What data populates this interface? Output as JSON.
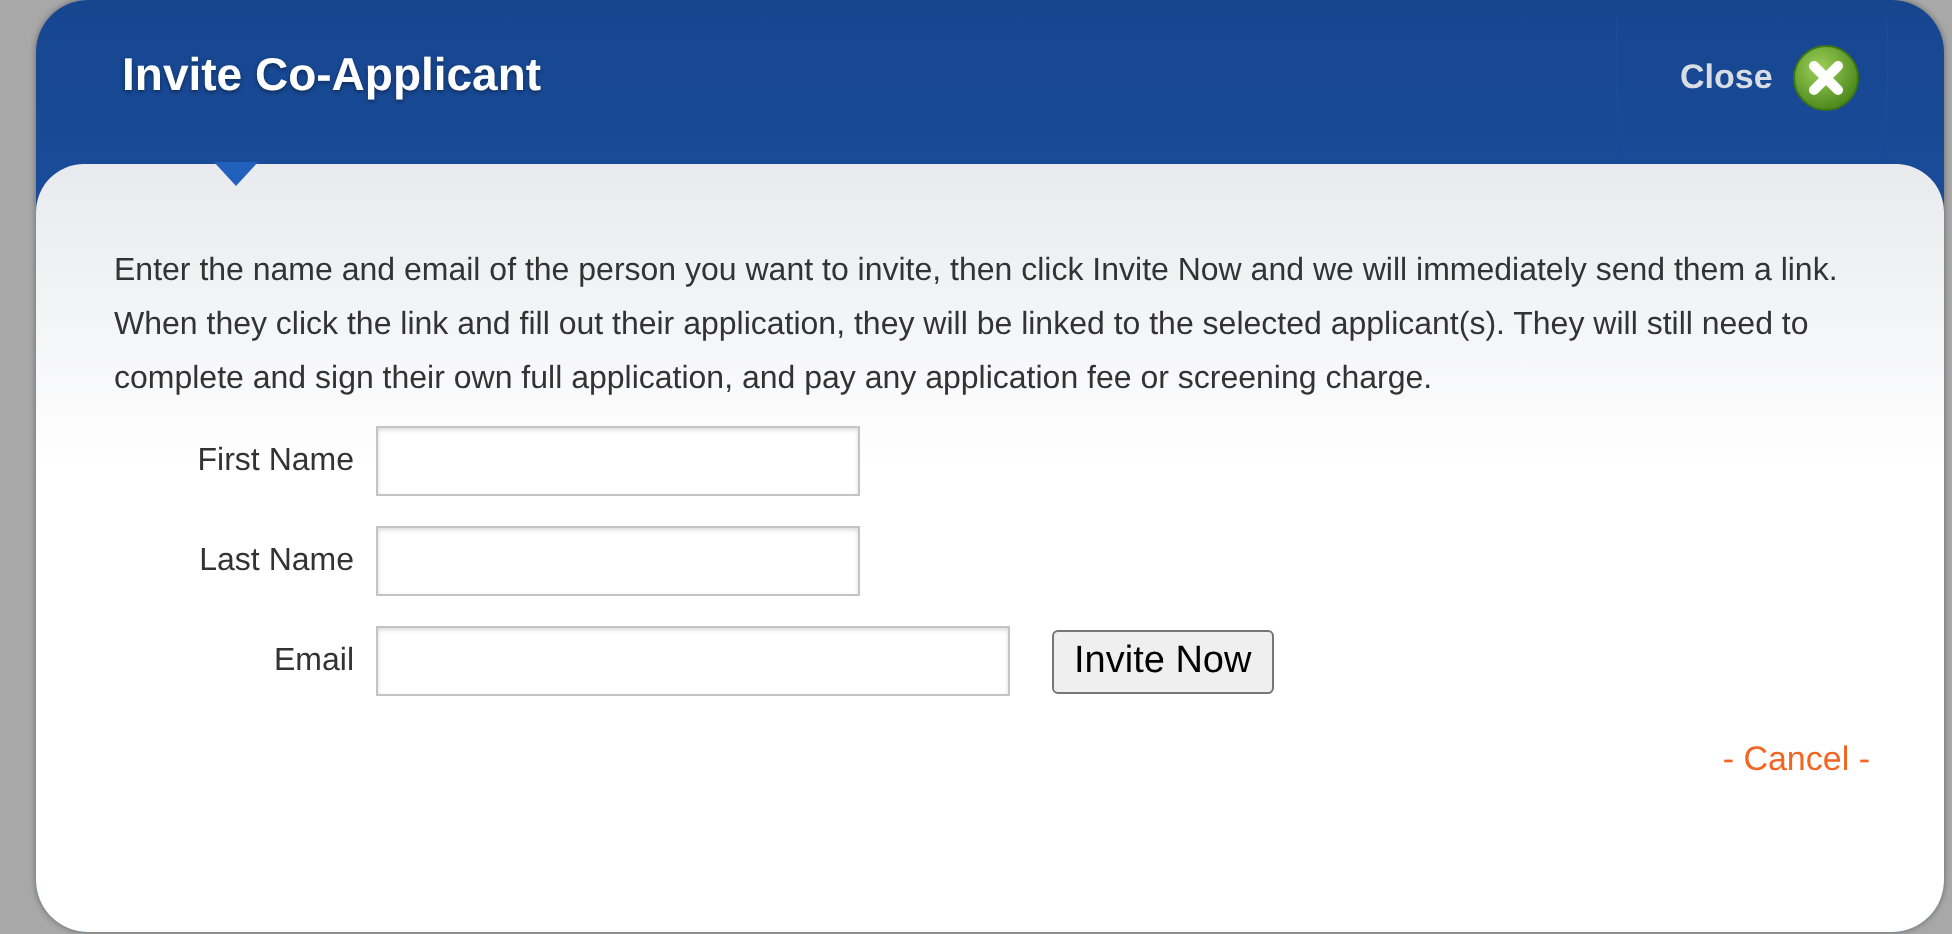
{
  "dialog": {
    "title": "Invite Co-Applicant",
    "close_label": "Close",
    "message": "Enter the name and email of the person you want to invite, then click Invite Now and we will immediately send them a link. When they click the link and fill out their application, they will be linked to the selected applicant(s). They will still need to complete and sign their own full application, and pay any application fee or screening charge.",
    "fields": [
      {
        "label": "First Name",
        "kind": "short"
      },
      {
        "label": "Last Name",
        "kind": "short"
      },
      {
        "label": "Email",
        "kind": "long"
      }
    ],
    "submit_button": "Invite Now",
    "cancel_link": "- Cancel -"
  }
}
